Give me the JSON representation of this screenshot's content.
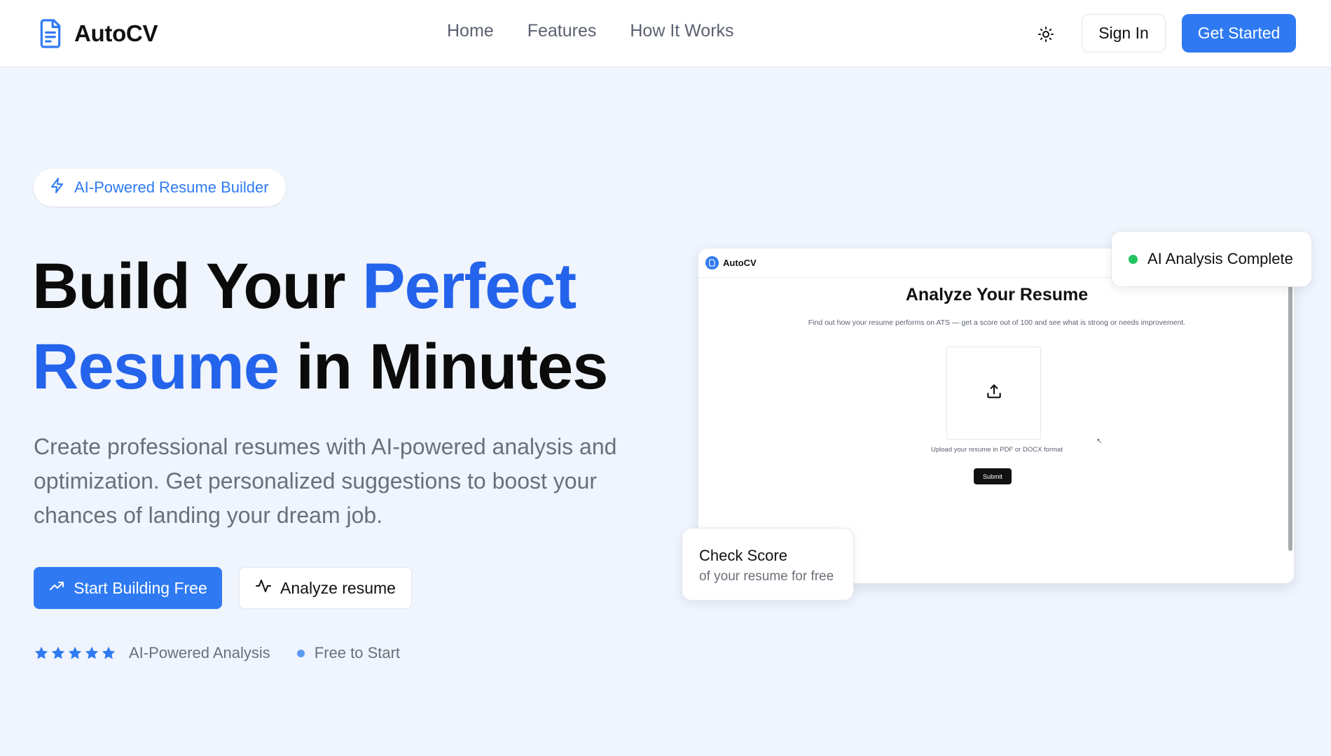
{
  "header": {
    "brand": "AutoCV",
    "nav": [
      {
        "label": "Home"
      },
      {
        "label": "Features"
      },
      {
        "label": "How It Works"
      }
    ],
    "theme_icon": "sun-icon",
    "sign_in": "Sign In",
    "get_started": "Get Started"
  },
  "hero": {
    "pill": "AI-Powered Resume Builder",
    "headline": {
      "part1": "Build Your ",
      "part2": "Perfect",
      "part3": "Resume",
      "part4": " in Minutes"
    },
    "subtext": "Create professional resumes with AI-powered analysis and optimization. Get personalized suggestions to boost your chances of landing your dream job.",
    "cta_primary": "Start Building Free",
    "cta_secondary": "Analyze resume",
    "rating_stars": 5,
    "proof": [
      "AI-Powered Analysis",
      "Free to Start"
    ]
  },
  "preview": {
    "brand": "AutoCV",
    "title": "Analyze Your Resume",
    "description": "Find out how your resume performs on ATS — get a score out of 100 and see what is strong or needs improvement.",
    "upload_text": "Upload your resume in PDF or DOCX format",
    "submit": "Submit"
  },
  "badges": {
    "analysis": "AI Analysis Complete",
    "score_title": "Check Score",
    "score_sub": "of your resume for free"
  },
  "colors": {
    "accent": "#2f7af2",
    "headline_blue": "#2463eb",
    "status_green": "#22c55e",
    "background": "#eff4fd"
  }
}
